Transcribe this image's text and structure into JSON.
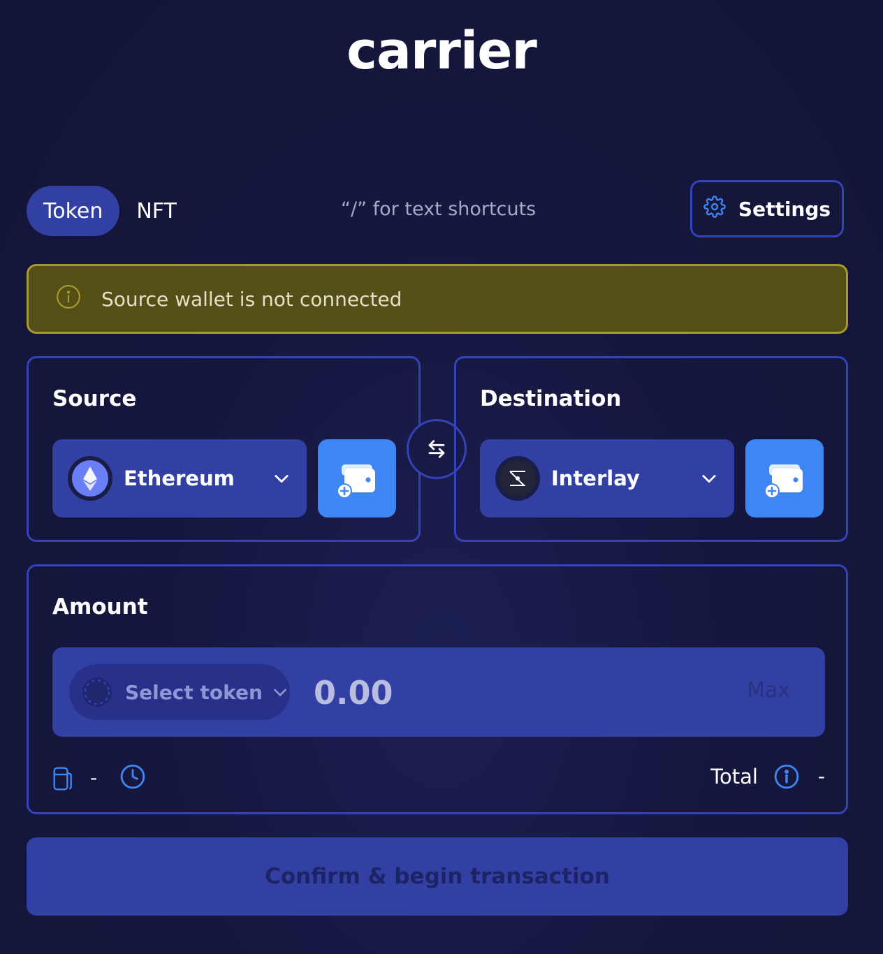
{
  "app": {
    "logo_text": "carrier"
  },
  "tabs": [
    {
      "label": "Token",
      "active": true
    },
    {
      "label": "NFT",
      "active": false
    }
  ],
  "shortcut_hint": "“/” for text shortcuts",
  "settings": {
    "label": "Settings",
    "icon": "gear-icon"
  },
  "alert": {
    "text": "Source wallet is not connected",
    "icon": "info-icon"
  },
  "source": {
    "title": "Source",
    "chain": "Ethereum",
    "chain_icon": "ethereum-logo",
    "wallet_button_icon": "add-wallet-icon"
  },
  "destination": {
    "title": "Destination",
    "chain": "Interlay",
    "chain_icon": "interlay-logo",
    "wallet_button_icon": "add-wallet-icon"
  },
  "swap_icon": "swap-arrows-icon",
  "amount": {
    "title": "Amount",
    "token_select_label": "Select token",
    "input_placeholder": "0.00",
    "input_value": "",
    "max_label": "Max",
    "fee_value": "-",
    "total_label": "Total",
    "total_value": "-"
  },
  "confirm_label": "Confirm & begin transaction",
  "colors": {
    "background": "#15173f",
    "accent": "#3240a4",
    "border": "#3443b8",
    "wallet_button": "#3d86f4",
    "alert_bg": "#544f16",
    "alert_border": "#a69a2a"
  }
}
